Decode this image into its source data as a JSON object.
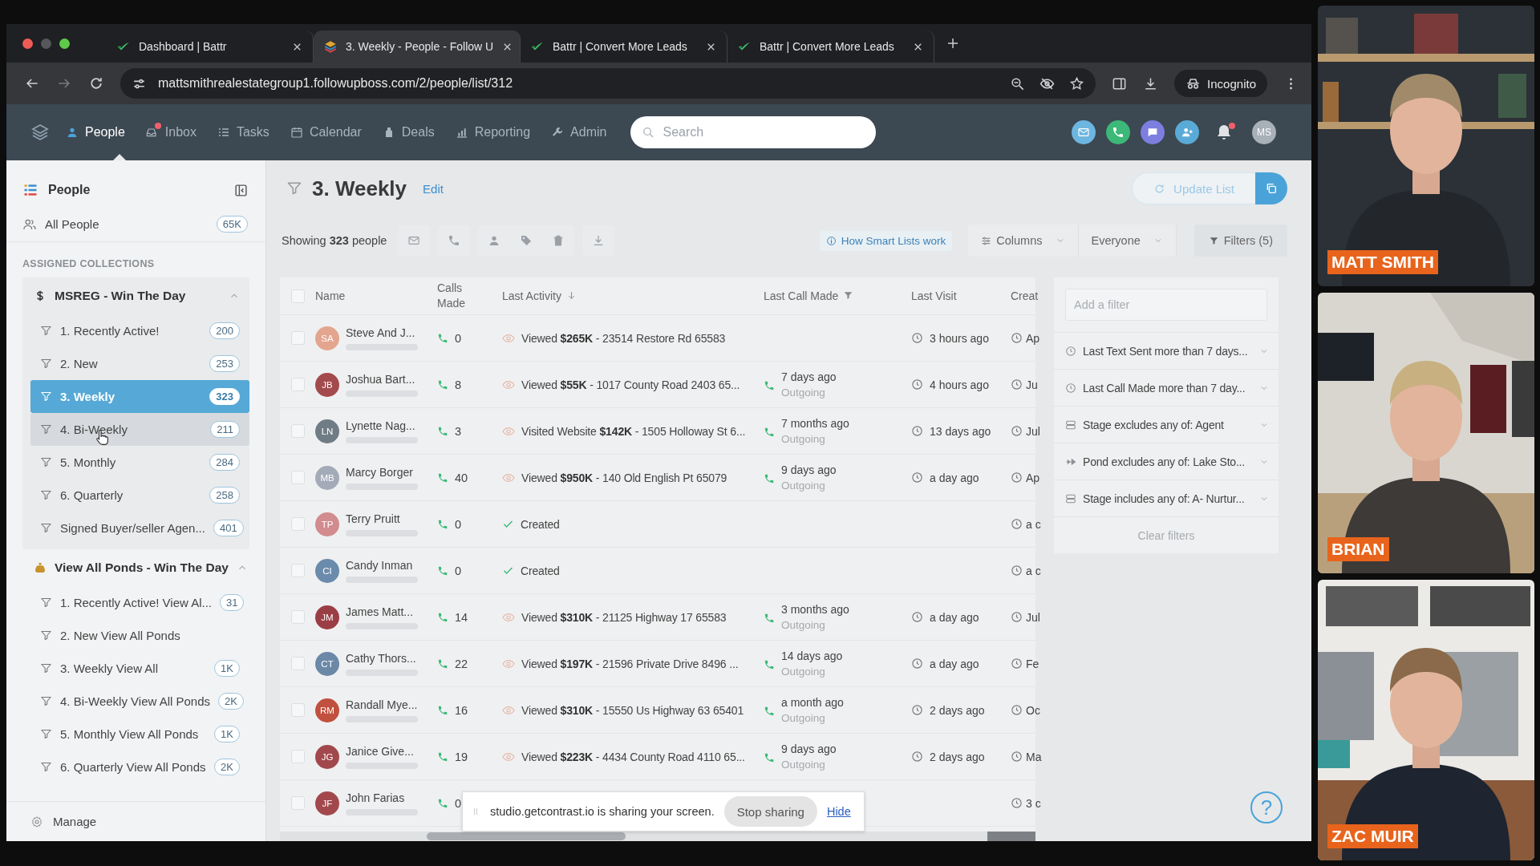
{
  "browser": {
    "tabs": [
      {
        "title": "Dashboard | Battr",
        "kind": "battr",
        "selected": false
      },
      {
        "title": "3. Weekly - People - Follow U",
        "kind": "fub",
        "selected": true
      },
      {
        "title": "Battr | Convert More Leads",
        "kind": "battr",
        "selected": false
      },
      {
        "title": "Battr | Convert More Leads",
        "kind": "battr",
        "selected": false
      }
    ],
    "url": "mattsmithrealestategroup1.followupboss.com/2/people/list/312",
    "profile": "Incognito"
  },
  "nav": {
    "items": [
      {
        "label": "People",
        "kind": "people",
        "selected": true,
        "badge": false
      },
      {
        "label": "Inbox",
        "kind": "inbox",
        "selected": false,
        "badge": true
      },
      {
        "label": "Tasks",
        "kind": "tasks",
        "selected": false,
        "badge": false
      },
      {
        "label": "Calendar",
        "kind": "calendar",
        "selected": false,
        "badge": false
      },
      {
        "label": "Deals",
        "kind": "deals",
        "selected": false,
        "badge": false
      },
      {
        "label": "Reporting",
        "kind": "reporting",
        "selected": false,
        "badge": false
      },
      {
        "label": "Admin",
        "kind": "admin",
        "selected": false,
        "badge": false
      }
    ],
    "search": {
      "placeholder": "Search"
    },
    "notifications": true,
    "avatar": "MS"
  },
  "sidebar": {
    "title": "People",
    "all": {
      "label": "All People",
      "count": "65K"
    },
    "section": "ASSIGNED COLLECTIONS",
    "groups": [
      {
        "name": "MSREG - Win The Day",
        "kind": "dollar",
        "expanded": true,
        "items": [
          {
            "label": "1. Recently Active!",
            "count": "200",
            "selected": false,
            "hovered": false
          },
          {
            "label": "2. New",
            "count": "253",
            "selected": false,
            "hovered": false
          },
          {
            "label": "3. Weekly",
            "count": "323",
            "selected": true,
            "hovered": false
          },
          {
            "label": "4. Bi-Weekly",
            "count": "211",
            "selected": false,
            "hovered": true
          },
          {
            "label": "5. Monthly",
            "count": "284",
            "selected": false,
            "hovered": false
          },
          {
            "label": "6. Quarterly",
            "count": "258",
            "selected": false,
            "hovered": false
          },
          {
            "label": "Signed Buyer/seller Agen...",
            "count": "401",
            "selected": false,
            "hovered": false
          }
        ]
      },
      {
        "name": "View All Ponds - Win The Day",
        "kind": "bag",
        "expanded": true,
        "items": [
          {
            "label": "1. Recently Active! View Al...",
            "count": "31",
            "selected": false,
            "hovered": false
          },
          {
            "label": "2. New View All Ponds",
            "selected": false,
            "hovered": false
          },
          {
            "label": "3. Weekly View All",
            "count": "1K",
            "selected": false,
            "hovered": false
          },
          {
            "label": "4. Bi-Weekly View All Ponds",
            "count": "2K",
            "selected": false,
            "hovered": false
          },
          {
            "label": "5. Monthly View All Ponds",
            "count": "1K",
            "selected": false,
            "hovered": false
          },
          {
            "label": "6. Quarterly View All Ponds",
            "count": "2K",
            "selected": false,
            "hovered": false
          }
        ]
      }
    ],
    "manage": "Manage"
  },
  "list": {
    "title": "3. Weekly",
    "edit": "Edit",
    "update": "Update List",
    "showing": "Showing **323** people",
    "help_link": "How Smart Lists work",
    "columns": "Columns",
    "owner": "Everyone",
    "filters": "Filters (5)"
  },
  "table": {
    "select_all": {
      "checked": false
    },
    "columns": [
      {
        "label": "Name",
        "sorted": false,
        "filtered": false
      },
      {
        "label": "Calls Made",
        "sorted": false,
        "filtered": false
      },
      {
        "label": "Last Activity",
        "sorted": true,
        "filtered": false
      },
      {
        "label": "Last Call Made",
        "sorted": false,
        "filtered": true
      },
      {
        "label": "Last Visit",
        "sorted": false,
        "filtered": false
      },
      {
        "label": "Creat",
        "sorted": false,
        "filtered": false
      }
    ],
    "rows": [
      {
        "checked": false,
        "initials": "SA",
        "color": "#e4a58e",
        "name": "Steve And J...",
        "calls": "0",
        "activity": {
          "kind": "viewed",
          "text": "Viewed **$265K** - 23514 Restore Rd 65583"
        },
        "last_visit": "3 hours ago",
        "created": "Ap"
      },
      {
        "checked": false,
        "initials": "JB",
        "color": "#a34a4c",
        "name": "Joshua Bart...",
        "calls": "8",
        "activity": {
          "kind": "viewed",
          "text": "Viewed **$55K** - 1017 County Road 2403 65..."
        },
        "last_call": {
          "when": "7 days ago",
          "direction": "Outgoing"
        },
        "last_visit": "4 hours ago",
        "created": "Ju"
      },
      {
        "checked": false,
        "initials": "LN",
        "color": "#6f7c85",
        "name": "Lynette Nag...",
        "calls": "3",
        "activity": {
          "kind": "viewed",
          "text": "Visited Website **$142K** - 1505 Holloway St 6..."
        },
        "last_call": {
          "when": "7 months ago",
          "direction": "Outgoing"
        },
        "last_visit": "13 days ago",
        "created": "Jul"
      },
      {
        "checked": false,
        "initials": "MB",
        "color": "#a3aab8",
        "name": "Marcy Borger",
        "calls": "40",
        "activity": {
          "kind": "viewed",
          "text": "Viewed **$950K** - 140 Old English Pt 65079"
        },
        "last_call": {
          "when": "9 days ago",
          "direction": "Outgoing"
        },
        "last_visit": "a day ago",
        "created": "Ap"
      },
      {
        "checked": false,
        "initials": "TP",
        "color": "#d28b8e",
        "name": "Terry Pruitt",
        "calls": "0",
        "activity": {
          "kind": "created",
          "text": "Created"
        },
        "created": "a c"
      },
      {
        "checked": false,
        "initials": "CI",
        "color": "#6a8bab",
        "name": "Candy Inman",
        "calls": "0",
        "activity": {
          "kind": "created",
          "text": "Created"
        },
        "created": "a c"
      },
      {
        "checked": false,
        "initials": "JM",
        "color": "#9b3d45",
        "name": "James Matt...",
        "calls": "14",
        "activity": {
          "kind": "viewed",
          "text": "Viewed **$310K** - 21125 Highway 17 65583"
        },
        "last_call": {
          "when": "3 months ago",
          "direction": "Outgoing"
        },
        "last_visit": "a day ago",
        "created": "Jul"
      },
      {
        "checked": false,
        "initials": "CT",
        "color": "#6b88a7",
        "name": "Cathy Thors...",
        "calls": "22",
        "activity": {
          "kind": "viewed",
          "text": "Viewed **$197K** - 21596 Private Drive 8496 ..."
        },
        "last_call": {
          "when": "14 days ago",
          "direction": "Outgoing"
        },
        "last_visit": "a day ago",
        "created": "Fe"
      },
      {
        "checked": false,
        "initials": "RM",
        "color": "#c1503e",
        "name": "Randall Mye...",
        "calls": "16",
        "activity": {
          "kind": "viewed",
          "text": "Viewed **$310K** - 15550 Us Highway 63 65401"
        },
        "last_call": {
          "when": "a month ago",
          "direction": "Outgoing"
        },
        "last_visit": "2 days ago",
        "created": "Oc"
      },
      {
        "checked": false,
        "initials": "JG",
        "color": "#a2484c",
        "name": "Janice Give...",
        "calls": "19",
        "activity": {
          "kind": "viewed",
          "text": "Viewed **$223K** - 4434 County Road 4110 65..."
        },
        "last_call": {
          "when": "9 days ago",
          "direction": "Outgoing"
        },
        "last_visit": "2 days ago",
        "created": "Ma"
      },
      {
        "checked": false,
        "initials": "JF",
        "color": "#a2484c",
        "name": "John Farias",
        "calls": "0",
        "created": "3 c"
      }
    ]
  },
  "filters": {
    "placeholder": "Add a filter",
    "items": [
      {
        "kind": "clock",
        "label": "Last Text Sent more than 7 days..."
      },
      {
        "kind": "clock",
        "label": "Last Call Made more than 7 day..."
      },
      {
        "kind": "stage",
        "label": "Stage excludes any of: Agent"
      },
      {
        "kind": "pond",
        "label": "Pond excludes any of: Lake Sto..."
      },
      {
        "kind": "stage",
        "label": "Stage includes any of: A- Nurtur..."
      }
    ],
    "clear": "Clear filters"
  },
  "share_bar": {
    "text": "studio.getcontrast.io is sharing your screen.",
    "stop": "Stop sharing",
    "hide": "Hide"
  },
  "help": "?",
  "video": [
    {
      "name": "MATT SMITH"
    },
    {
      "name": "BRIAN"
    },
    {
      "name": "ZAC MUIR"
    }
  ]
}
